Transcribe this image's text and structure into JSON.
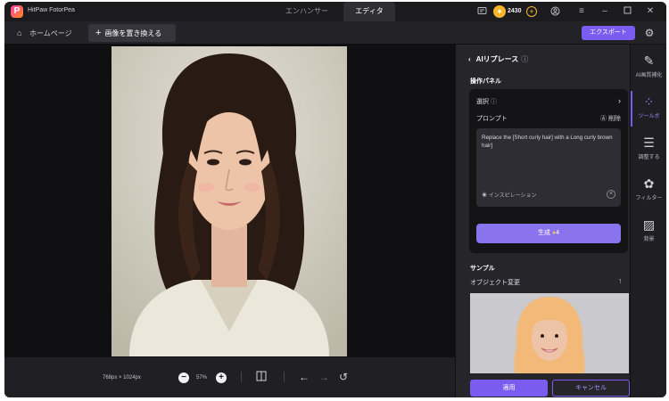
{
  "app": {
    "title": "HitPaw FotorPea",
    "logo_letter": "P"
  },
  "tabs": {
    "enhancer": "エンハンサー",
    "editor": "エディタ"
  },
  "titlebar": {
    "coins": "2430"
  },
  "toolbar": {
    "home": "ホームページ",
    "document": "画像を置き換える",
    "export": "エクスポート"
  },
  "panel": {
    "title": "AIリプレース",
    "ops_label": "操作パネル",
    "select_label": "選択",
    "prompt_label": "プロンプト",
    "clear_label": "削除",
    "prompt_text": "Replace the [Short curly hair] with a Long curly brown hair]",
    "inspiration": "インスピレーション",
    "generate": "生成",
    "generate_cost": "4",
    "sample_label": "サンプル",
    "sample_sub": "オブジェクト変更",
    "apply": "適用",
    "cancel": "キャンセル"
  },
  "canvas": {
    "size": "768px × 1024px",
    "zoom": "57%"
  },
  "rail": {
    "items": [
      {
        "icon": "ai-enhance-icon",
        "label": "AI画質補化"
      },
      {
        "icon": "tools-icon",
        "label": "ツールボ"
      },
      {
        "icon": "adjust-icon",
        "label": "調整する"
      },
      {
        "icon": "filter-icon",
        "label": "フィルター"
      },
      {
        "icon": "background-icon",
        "label": "背景"
      }
    ]
  },
  "colors": {
    "accent": "#7b5cf0",
    "background": "#1c1c1f",
    "panel": "#25252a"
  }
}
